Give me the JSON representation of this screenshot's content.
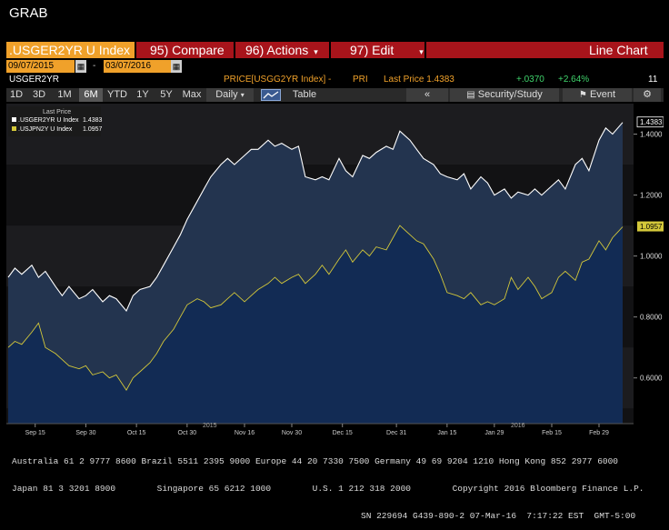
{
  "app": {
    "title": "GRAB"
  },
  "toolbar": {
    "ticker": ".USGER2YR U Index",
    "compare": "95) Compare",
    "actions": "96) Actions",
    "edit": "97) Edit",
    "chart_type": "Line Chart",
    "dropdown_glyph": "▾"
  },
  "dates": {
    "start": "09/07/2015",
    "dash": "-",
    "end": "03/07/2016",
    "calendar_glyph": "▦"
  },
  "info": {
    "security": "USGER2YR",
    "field": "PRICE[USGG2YR Index] -",
    "pri": "PRI",
    "last_price": "Last Price 1.4383",
    "change": "+.0370",
    "pct_change": "+2.64%",
    "count": "11"
  },
  "periods": [
    "1D",
    "3D",
    "1M",
    "6M",
    "YTD",
    "1Y",
    "5Y",
    "Max"
  ],
  "active_period": "6M",
  "frequency": "Daily",
  "table_label": "Table",
  "security_study": "Security/Study",
  "event": "Event",
  "legend": {
    "header": "Last Price",
    "items": [
      {
        "name": ".USGER2YR U Index",
        "value": "1.4383",
        "color": "#ffffff"
      },
      {
        "name": ".USJPN2Y U Index",
        "value": "1.0957",
        "color": "#d4c83a"
      }
    ]
  },
  "y_ticks": [
    "1.4000",
    "1.2000",
    "1.0000",
    "0.8000",
    "0.6000"
  ],
  "last_value_badges": [
    "1.4383",
    "1.0957"
  ],
  "x_ticks": [
    "Sep 15",
    "Sep 30",
    "Oct 15",
    "Oct 30",
    "Nov 16",
    "Nov 30",
    "Dec 15",
    "Dec 31",
    "Jan 15",
    "Jan 29",
    "Feb 15",
    "Feb 29"
  ],
  "years": [
    "2015",
    "2016"
  ],
  "footer": {
    "line1": "Australia 61 2 9777 8600 Brazil 5511 2395 9000 Europe 44 20 7330 7500 Germany 49 69 9204 1210 Hong Kong 852 2977 6000",
    "line2": "Japan 81 3 3201 8900        Singapore 65 6212 1000        U.S. 1 212 318 2000        Copyright 2016 Bloomberg Finance L.P.",
    "line3": "SN 229694 G439-890-2 07-Mar-16  7:17:22 EST  GMT-5:00"
  },
  "colors": {
    "accent_red": "#a8141b",
    "orange": "#f0a12a",
    "series1": "#ffffff",
    "series2": "#d4c83a"
  },
  "chart_data": {
    "type": "line",
    "title": "",
    "ylim": [
      0.45,
      1.5
    ],
    "series": [
      {
        "name": ".USGER2YR U Index",
        "color": "#ffffff",
        "x": [
          "2015-09-07",
          "2015-09-09",
          "2015-09-11",
          "2015-09-14",
          "2015-09-16",
          "2015-09-18",
          "2015-09-21",
          "2015-09-23",
          "2015-09-25",
          "2015-09-28",
          "2015-09-30",
          "2015-10-02",
          "2015-10-05",
          "2015-10-07",
          "2015-10-09",
          "2015-10-12",
          "2015-10-14",
          "2015-10-16",
          "2015-10-19",
          "2015-10-21",
          "2015-10-23",
          "2015-10-26",
          "2015-10-28",
          "2015-10-30",
          "2015-11-02",
          "2015-11-04",
          "2015-11-06",
          "2015-11-09",
          "2015-11-11",
          "2015-11-13",
          "2015-11-16",
          "2015-11-18",
          "2015-11-20",
          "2015-11-23",
          "2015-11-25",
          "2015-11-27",
          "2015-11-30",
          "2015-12-02",
          "2015-12-04",
          "2015-12-07",
          "2015-12-09",
          "2015-12-11",
          "2015-12-14",
          "2015-12-16",
          "2015-12-18",
          "2015-12-21",
          "2015-12-23",
          "2015-12-25",
          "2015-12-28",
          "2015-12-30",
          "2016-01-01",
          "2016-01-04",
          "2016-01-06",
          "2016-01-08",
          "2016-01-11",
          "2016-01-13",
          "2016-01-15",
          "2016-01-18",
          "2016-01-20",
          "2016-01-22",
          "2016-01-25",
          "2016-01-27",
          "2016-01-29",
          "2016-02-01",
          "2016-02-03",
          "2016-02-05",
          "2016-02-08",
          "2016-02-10",
          "2016-02-12",
          "2016-02-15",
          "2016-02-17",
          "2016-02-19",
          "2016-02-22",
          "2016-02-24",
          "2016-02-26",
          "2016-02-29",
          "2016-03-02",
          "2016-03-04",
          "2016-03-07"
        ],
        "values": [
          0.93,
          0.96,
          0.94,
          0.97,
          0.93,
          0.95,
          0.9,
          0.87,
          0.9,
          0.86,
          0.87,
          0.89,
          0.85,
          0.87,
          0.86,
          0.82,
          0.87,
          0.89,
          0.9,
          0.93,
          0.97,
          1.03,
          1.07,
          1.12,
          1.18,
          1.22,
          1.26,
          1.3,
          1.32,
          1.3,
          1.33,
          1.35,
          1.35,
          1.38,
          1.36,
          1.37,
          1.35,
          1.36,
          1.26,
          1.25,
          1.26,
          1.25,
          1.32,
          1.28,
          1.26,
          1.33,
          1.32,
          1.34,
          1.36,
          1.35,
          1.41,
          1.38,
          1.35,
          1.32,
          1.3,
          1.27,
          1.26,
          1.25,
          1.27,
          1.22,
          1.26,
          1.24,
          1.2,
          1.22,
          1.19,
          1.21,
          1.2,
          1.22,
          1.2,
          1.23,
          1.25,
          1.22,
          1.3,
          1.32,
          1.28,
          1.38,
          1.42,
          1.4,
          1.4383
        ]
      },
      {
        "name": ".USJPN2Y U Index",
        "color": "#d4c83a",
        "x": [
          "2015-09-07",
          "2015-09-09",
          "2015-09-11",
          "2015-09-14",
          "2015-09-16",
          "2015-09-18",
          "2015-09-21",
          "2015-09-23",
          "2015-09-25",
          "2015-09-28",
          "2015-09-30",
          "2015-10-02",
          "2015-10-05",
          "2015-10-07",
          "2015-10-09",
          "2015-10-12",
          "2015-10-14",
          "2015-10-16",
          "2015-10-19",
          "2015-10-21",
          "2015-10-23",
          "2015-10-26",
          "2015-10-28",
          "2015-10-30",
          "2015-11-02",
          "2015-11-04",
          "2015-11-06",
          "2015-11-09",
          "2015-11-11",
          "2015-11-13",
          "2015-11-16",
          "2015-11-18",
          "2015-11-20",
          "2015-11-23",
          "2015-11-25",
          "2015-11-27",
          "2015-11-30",
          "2015-12-02",
          "2015-12-04",
          "2015-12-07",
          "2015-12-09",
          "2015-12-11",
          "2015-12-14",
          "2015-12-16",
          "2015-12-18",
          "2015-12-21",
          "2015-12-23",
          "2015-12-25",
          "2015-12-28",
          "2015-12-30",
          "2016-01-01",
          "2016-01-04",
          "2016-01-06",
          "2016-01-08",
          "2016-01-11",
          "2016-01-13",
          "2016-01-15",
          "2016-01-18",
          "2016-01-20",
          "2016-01-22",
          "2016-01-25",
          "2016-01-27",
          "2016-01-29",
          "2016-02-01",
          "2016-02-03",
          "2016-02-05",
          "2016-02-08",
          "2016-02-10",
          "2016-02-12",
          "2016-02-15",
          "2016-02-17",
          "2016-02-19",
          "2016-02-22",
          "2016-02-24",
          "2016-02-26",
          "2016-02-29",
          "2016-03-02",
          "2016-03-04",
          "2016-03-07"
        ],
        "values": [
          0.7,
          0.72,
          0.71,
          0.75,
          0.78,
          0.7,
          0.68,
          0.66,
          0.64,
          0.63,
          0.64,
          0.61,
          0.62,
          0.6,
          0.61,
          0.56,
          0.6,
          0.62,
          0.65,
          0.68,
          0.72,
          0.76,
          0.8,
          0.84,
          0.86,
          0.85,
          0.83,
          0.84,
          0.86,
          0.88,
          0.85,
          0.87,
          0.89,
          0.91,
          0.93,
          0.91,
          0.93,
          0.94,
          0.91,
          0.94,
          0.97,
          0.94,
          0.99,
          1.02,
          0.98,
          1.02,
          1.0,
          1.03,
          1.02,
          1.06,
          1.1,
          1.07,
          1.05,
          1.04,
          0.99,
          0.94,
          0.88,
          0.87,
          0.86,
          0.88,
          0.84,
          0.85,
          0.84,
          0.86,
          0.93,
          0.89,
          0.93,
          0.9,
          0.86,
          0.88,
          0.93,
          0.95,
          0.92,
          0.98,
          0.99,
          1.05,
          1.02,
          1.06,
          1.0957
        ]
      }
    ]
  }
}
